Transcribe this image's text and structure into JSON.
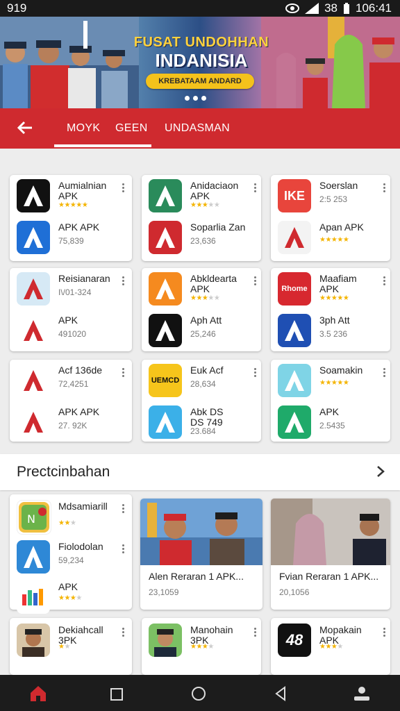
{
  "status_bar": {
    "time": "919",
    "right_text": "38",
    "clock": "106:41"
  },
  "banner": {
    "title_line1": "FUSAT UNDOHHAN",
    "title_line2": "INDANISIA",
    "button_label": "KREBATAAM ANDARD"
  },
  "tabs": [
    "MOYK",
    "GEEN",
    "UNDASMAN"
  ],
  "grid": [
    {
      "top": {
        "name": "Aumialnian\nAPK",
        "stars": 5
      },
      "bottom": {
        "name": "APK APK",
        "count": "75,839"
      }
    },
    {
      "top": {
        "name": "Anidaciaon\nAPK",
        "stars": 3
      },
      "bottom": {
        "name": "Soparlia Zan",
        "count": "23,636"
      }
    },
    {
      "top": {
        "name": "Soerslan",
        "count": "2:5 253",
        "icon_text": "IKE"
      },
      "bottom": {
        "name": "Apan APK",
        "stars": 5
      }
    },
    {
      "top": {
        "name": "Reisianaran",
        "count": "I\\/01-324"
      },
      "bottom": {
        "name": "APK",
        "count": "491020"
      }
    },
    {
      "top": {
        "name": "Abkldearta\nAPK",
        "stars": 3
      },
      "bottom": {
        "name": "Aph Att",
        "count": "25,246"
      }
    },
    {
      "top": {
        "name": "Maafiam\nAPK",
        "stars": 5,
        "icon_text": "Rhome"
      },
      "bottom": {
        "name": "3ph Att",
        "count": "3.5 236"
      }
    },
    {
      "top": {
        "name": "Acf 136de",
        "count": "72,4251"
      },
      "bottom": {
        "name": "APK APK",
        "count": "27. 92K"
      }
    },
    {
      "top": {
        "name": "Euk Acf",
        "count": "28,634",
        "icon_text": "UEMCD"
      },
      "bottom": {
        "name": "Abk DS\nDS 749",
        "count": "23.684"
      }
    },
    {
      "top": {
        "name": "Soamakin",
        "stars": 5
      },
      "bottom": {
        "name": "APK",
        "count": "2.5435"
      }
    }
  ],
  "section": {
    "title": "Prectcinbahan"
  },
  "section_list": [
    {
      "name": "Mdsamiarill",
      "stars": 2
    },
    {
      "name": "Fiolodolan",
      "count": "59,234"
    },
    {
      "name": "APK",
      "stars": 3
    }
  ],
  "promos": [
    {
      "title": "Alen Reraran 1 APK...",
      "count": "23,1059"
    },
    {
      "title": "Fvian Reraran 1 APK...",
      "count": "20,1056"
    }
  ],
  "bottom_row": [
    {
      "name": "Dekiahcall\n3PK",
      "stars": 1
    },
    {
      "name": "Manohain\n3PK",
      "stars": 3
    },
    {
      "name": "Mopakain\nAPK",
      "stars": 3,
      "icon_text": "48"
    }
  ],
  "colors": {
    "accent": "#cf2a2f",
    "star": "#f4b400"
  }
}
